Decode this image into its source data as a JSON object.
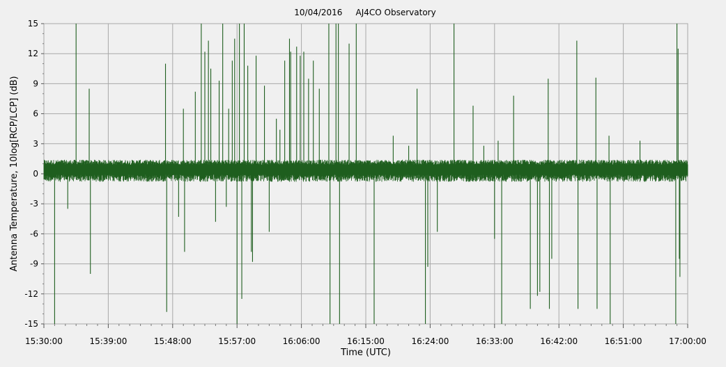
{
  "chart_data": {
    "type": "line",
    "title": "10/04/2016     AJ4CO Observatory",
    "xlabel": "Time (UTC)",
    "ylabel": "Antenna Temperature, 10log[RCP/LCP] (dB)",
    "xlim": [
      "15:30:00",
      "17:00:00"
    ],
    "ylim": [
      -15,
      15
    ],
    "x_ticks": [
      "15:30:00",
      "15:39:00",
      "15:48:00",
      "15:57:00",
      "16:06:00",
      "16:15:00",
      "16:24:00",
      "16:33:00",
      "16:42:00",
      "16:51:00",
      "17:00:00"
    ],
    "y_ticks": [
      "15",
      "12",
      "9",
      "6",
      "3",
      "0",
      "-3",
      "-6",
      "-9",
      "-12",
      "-15"
    ],
    "grid": true,
    "baseline_db": 0.5,
    "noise_band_db": [
      -0.8,
      1.4
    ],
    "series": [
      {
        "color": "#1e5e1e",
        "spikes": [
          {
            "t": "15:31:30",
            "v": -15
          },
          {
            "t": "15:33:20",
            "v": -3.5
          },
          {
            "t": "15:34:30",
            "v": 15
          },
          {
            "t": "15:36:20",
            "v": 8.5
          },
          {
            "t": "15:36:30",
            "v": -10
          },
          {
            "t": "15:47:00",
            "v": 11
          },
          {
            "t": "15:47:10",
            "v": -13.8
          },
          {
            "t": "15:48:50",
            "v": -4.3
          },
          {
            "t": "15:49:30",
            "v": 6.5
          },
          {
            "t": "15:49:40",
            "v": -7.8
          },
          {
            "t": "15:51:10",
            "v": 8.2
          },
          {
            "t": "15:52:00",
            "v": 15
          },
          {
            "t": "15:52:30",
            "v": 12.2
          },
          {
            "t": "15:53:00",
            "v": 13.3
          },
          {
            "t": "15:53:20",
            "v": 10.5
          },
          {
            "t": "15:54:00",
            "v": -4.8
          },
          {
            "t": "15:54:30",
            "v": 9.3
          },
          {
            "t": "15:55:00",
            "v": 15
          },
          {
            "t": "15:55:30",
            "v": -3.3
          },
          {
            "t": "15:55:50",
            "v": 6.5
          },
          {
            "t": "15:56:20",
            "v": 11.3
          },
          {
            "t": "15:56:40",
            "v": 13.5
          },
          {
            "t": "15:57:00",
            "v": -15
          },
          {
            "t": "15:57:20",
            "v": 15
          },
          {
            "t": "15:57:40",
            "v": -12.5
          },
          {
            "t": "15:58:00",
            "v": 15
          },
          {
            "t": "15:58:30",
            "v": 10.8
          },
          {
            "t": "15:59:00",
            "v": -7.8
          },
          {
            "t": "15:59:10",
            "v": -8.8
          },
          {
            "t": "15:59:40",
            "v": 11.8
          },
          {
            "t": "16:00:50",
            "v": 8.8
          },
          {
            "t": "16:01:30",
            "v": -5.8
          },
          {
            "t": "16:02:30",
            "v": 5.5
          },
          {
            "t": "16:03:00",
            "v": 4.4
          },
          {
            "t": "16:03:40",
            "v": 11.3
          },
          {
            "t": "16:04:20",
            "v": 13.5
          },
          {
            "t": "16:04:30",
            "v": 12.2
          },
          {
            "t": "16:05:20",
            "v": 12.7
          },
          {
            "t": "16:05:50",
            "v": 11.8
          },
          {
            "t": "16:06:20",
            "v": 12.2
          },
          {
            "t": "16:07:00",
            "v": 9.5
          },
          {
            "t": "16:07:40",
            "v": 11.3
          },
          {
            "t": "16:08:30",
            "v": 8.5
          },
          {
            "t": "16:09:50",
            "v": 15
          },
          {
            "t": "16:10:00",
            "v": -15
          },
          {
            "t": "16:10:50",
            "v": 15
          },
          {
            "t": "16:11:10",
            "v": 15
          },
          {
            "t": "16:11:20",
            "v": -15
          },
          {
            "t": "16:12:40",
            "v": 13
          },
          {
            "t": "16:13:40",
            "v": 15
          },
          {
            "t": "16:16:10",
            "v": -15
          },
          {
            "t": "16:18:50",
            "v": 3.8
          },
          {
            "t": "16:21:00",
            "v": 2.8
          },
          {
            "t": "16:22:10",
            "v": 8.5
          },
          {
            "t": "16:23:20",
            "v": -15
          },
          {
            "t": "16:23:40",
            "v": -9.3
          },
          {
            "t": "16:25:00",
            "v": -5.8
          },
          {
            "t": "16:27:20",
            "v": 15
          },
          {
            "t": "16:30:00",
            "v": 6.8
          },
          {
            "t": "16:31:30",
            "v": 2.8
          },
          {
            "t": "16:33:00",
            "v": -6.5
          },
          {
            "t": "16:33:30",
            "v": 3.3
          },
          {
            "t": "16:34:00",
            "v": -15
          },
          {
            "t": "16:35:40",
            "v": 7.8
          },
          {
            "t": "16:38:00",
            "v": -13.5
          },
          {
            "t": "16:39:00",
            "v": -12.2
          },
          {
            "t": "16:39:20",
            "v": -11.8
          },
          {
            "t": "16:40:30",
            "v": 9.5
          },
          {
            "t": "16:40:40",
            "v": -13.5
          },
          {
            "t": "16:41:00",
            "v": -8.5
          },
          {
            "t": "16:44:30",
            "v": 13.3
          },
          {
            "t": "16:44:40",
            "v": -13.5
          },
          {
            "t": "16:47:10",
            "v": 9.6
          },
          {
            "t": "16:47:20",
            "v": -13.5
          },
          {
            "t": "16:49:00",
            "v": 3.8
          },
          {
            "t": "16:49:10",
            "v": -15
          },
          {
            "t": "16:53:20",
            "v": 3.3
          },
          {
            "t": "16:58:20",
            "v": -15
          },
          {
            "t": "16:58:30",
            "v": 15
          },
          {
            "t": "16:58:40",
            "v": 12.5
          },
          {
            "t": "16:58:50",
            "v": -8.5
          },
          {
            "t": "16:58:55",
            "v": -10.3
          }
        ]
      }
    ]
  }
}
